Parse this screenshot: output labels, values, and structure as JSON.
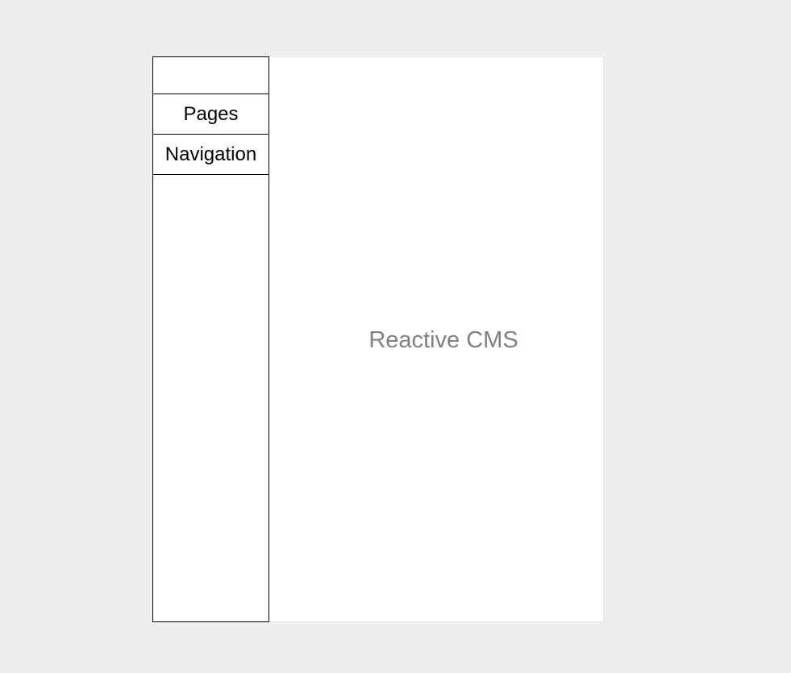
{
  "sidebar": {
    "items": [
      {
        "label": "Pages"
      },
      {
        "label": "Navigation"
      }
    ]
  },
  "main": {
    "brand_text": "Reactive CMS"
  },
  "colors": {
    "page_background": "#eeeeee",
    "panel_background": "#ffffff",
    "sidebar_border": "#000000",
    "brand_text": "#808080"
  }
}
